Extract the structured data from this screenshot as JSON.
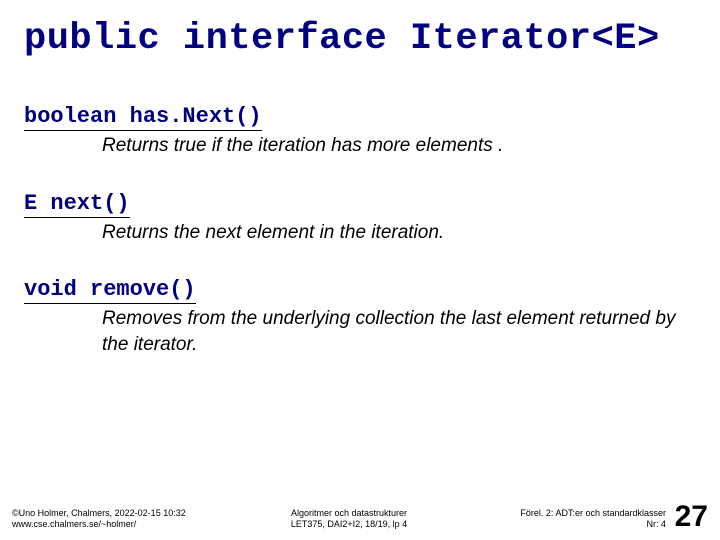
{
  "title": "public interface Iterator<E>",
  "methods": [
    {
      "signature": "boolean has.Next()",
      "description": "Returns true if the iteration has more elements ."
    },
    {
      "signature": "E next()",
      "description": "Returns the next element in the iteration."
    },
    {
      "signature": "void remove()",
      "description": "Removes from the underlying collection the last element returned by the iterator."
    }
  ],
  "footer": {
    "left_line1": "©Uno Holmer, Chalmers, 2022-02-15 10:32",
    "left_line2": "www.cse.chalmers.se/~holmer/",
    "center_line1": "Algoritmer och datastrukturer",
    "center_line2": "LET375, DAI2+I2, 18/19, lp 4",
    "right_line1": "Förel. 2: ADT:er och standardklasser",
    "right_line2": "Nr: 4"
  },
  "page_number": "27"
}
